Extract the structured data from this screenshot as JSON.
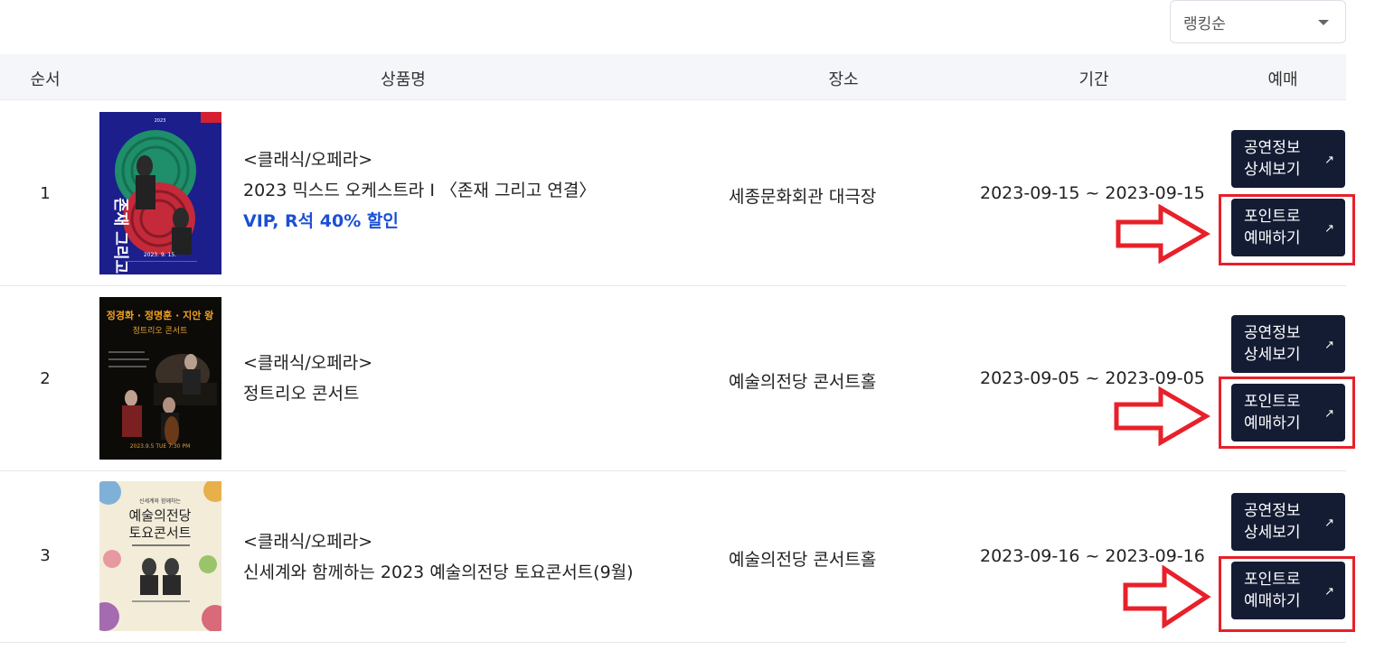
{
  "sort": {
    "selected": "랭킹순"
  },
  "table": {
    "headers": [
      "순서",
      "상품명",
      "장소",
      "기간",
      "예매"
    ]
  },
  "rows": [
    {
      "order": "1",
      "category": "<클래식/오페라>",
      "title": "2023 믹스드 오케스트라 I 〈존재 그리고 연결〉",
      "promo": "VIP, R석 40% 할인",
      "venue": "세종문화회관 대극장",
      "period": "2023-09-15 ~ 2023-09-15",
      "poster_text": [
        "존재 그리고 연결",
        "2023. 9. 15."
      ]
    },
    {
      "order": "2",
      "category": "<클래식/오페라>",
      "title": "정트리오 콘서트",
      "promo": "",
      "venue": "예술의전당 콘서트홀",
      "period": "2023-09-05 ~ 2023-09-05",
      "poster_text": [
        "정경화 · 정명훈 · 지안 왕",
        "정트리오 콘서트",
        "2023.9.5 TUE 7:30 PM"
      ]
    },
    {
      "order": "3",
      "category": "<클래식/오페라>",
      "title": "신세계와 함께하는 2023 예술의전당 토요콘서트(9월)",
      "promo": "",
      "venue": "예술의전당 콘서트홀",
      "period": "2023-09-16 ~ 2023-09-16",
      "poster_text": [
        "신세계와 함께하는",
        "예술의전당",
        "토요콘서트"
      ]
    }
  ],
  "buttons": {
    "detail_line1": "공연정보",
    "detail_line2": "상세보기",
    "book_line1": "포인트로",
    "book_line2": "예매하기",
    "arrow": "↗"
  },
  "colors": {
    "button_bg": "#141c33",
    "promo": "#1b4fd6",
    "highlight": "#e8202a",
    "header_bg": "#f5f6fa"
  }
}
